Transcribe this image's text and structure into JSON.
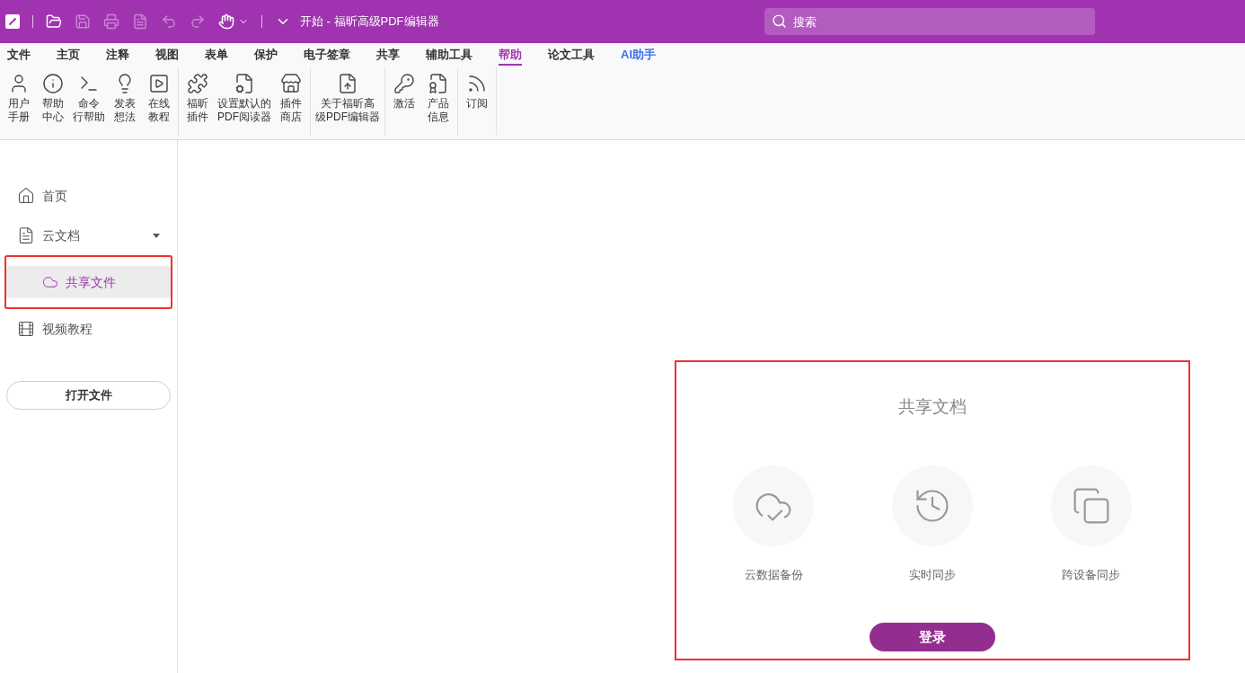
{
  "window": {
    "title": "开始 - 福昕高级PDF编辑器"
  },
  "search": {
    "placeholder": "搜索"
  },
  "menu_tabs": [
    {
      "label": "文件",
      "selected": false
    },
    {
      "label": "主页",
      "selected": false
    },
    {
      "label": "注释",
      "selected": false
    },
    {
      "label": "视图",
      "selected": false
    },
    {
      "label": "表单",
      "selected": false
    },
    {
      "label": "保护",
      "selected": false
    },
    {
      "label": "电子签章",
      "selected": false
    },
    {
      "label": "共享",
      "selected": false
    },
    {
      "label": "辅助工具",
      "selected": false
    },
    {
      "label": "帮助",
      "selected": true
    },
    {
      "label": "论文工具",
      "selected": false
    },
    {
      "label": "AI助手",
      "selected": false,
      "kind": "ai"
    }
  ],
  "ribbon_groups": [
    {
      "buttons": [
        {
          "lines": [
            "用户",
            "手册"
          ]
        },
        {
          "lines": [
            "帮助",
            "中心"
          ]
        },
        {
          "lines": [
            "命令",
            "行帮助"
          ]
        },
        {
          "lines": [
            "发表",
            "想法"
          ]
        },
        {
          "lines": [
            "在线",
            "教程"
          ]
        }
      ]
    },
    {
      "buttons": [
        {
          "lines": [
            "福昕",
            "插件"
          ]
        },
        {
          "lines": [
            "设置默认的",
            "PDF阅读器"
          ]
        },
        {
          "lines": [
            "插件",
            "商店"
          ]
        }
      ]
    },
    {
      "buttons": [
        {
          "lines": [
            "关于福昕高",
            "级PDF编辑器"
          ]
        }
      ]
    },
    {
      "buttons": [
        {
          "lines": [
            "激活"
          ]
        },
        {
          "lines": [
            "产品",
            "信息"
          ]
        }
      ]
    },
    {
      "buttons": [
        {
          "lines": [
            "订阅"
          ]
        }
      ]
    }
  ],
  "sidebar": {
    "items": [
      {
        "label": "首页",
        "selected": false
      },
      {
        "label": "云文档",
        "selected": false,
        "expanded": true,
        "children": [
          {
            "label": "共享文件",
            "selected": true
          }
        ]
      },
      {
        "label": "视频教程",
        "selected": false
      }
    ],
    "open_button": "打开文件"
  },
  "panel": {
    "title": "共享文档",
    "features": [
      "云数据备份",
      "实时同步",
      "跨设备同步"
    ],
    "login_button": "登录"
  }
}
